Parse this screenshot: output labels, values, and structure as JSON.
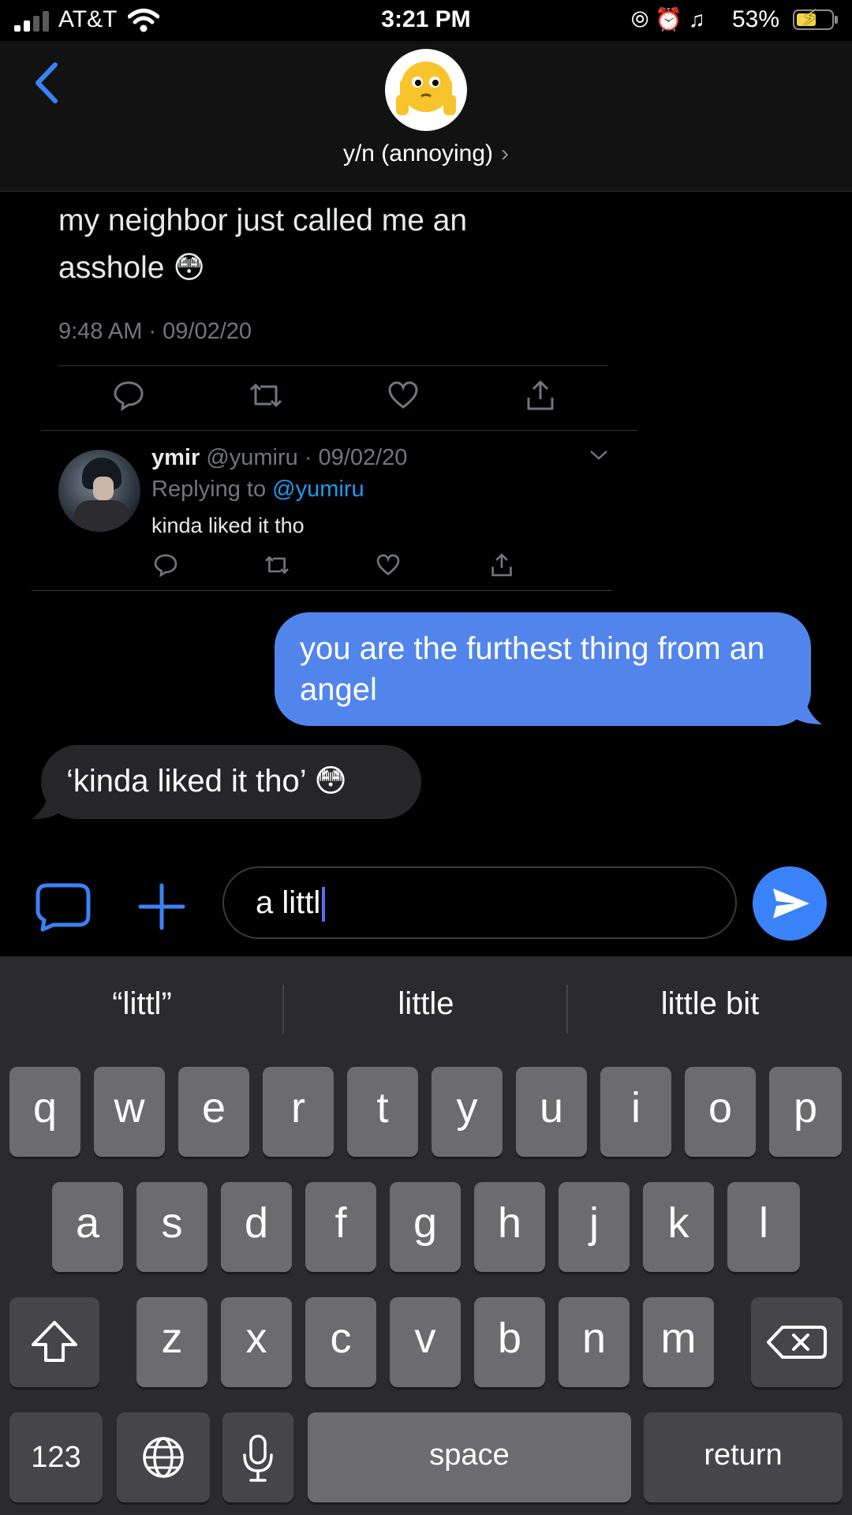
{
  "status_bar": {
    "carrier": "AT&T",
    "time": "3:21 PM",
    "battery_percent": "53%"
  },
  "header": {
    "contact_name": "y/n (annoying)",
    "avatar_icon": "smiley-middle-fingers-icon"
  },
  "tweet": {
    "text_line1": "my neighbor just called me an",
    "text_line2": "asshole",
    "emoji": "😳",
    "timestamp": "9:48 AM · 09/02/20",
    "reply": {
      "username": "ymir",
      "handle_date": "@yumiru · 09/02/20",
      "replying_prefix": "Replying to",
      "replying_handle": "@yumiru",
      "text": "kinda liked it tho"
    }
  },
  "messages": {
    "outgoing": "you are the furthest thing from an angel",
    "incoming": "‘kinda liked it tho’",
    "incoming_emoji": "😳"
  },
  "composer": {
    "input_value": "a littl"
  },
  "keyboard": {
    "suggestions": [
      "“littl”",
      "little",
      "little bit"
    ],
    "row1": [
      "q",
      "w",
      "e",
      "r",
      "t",
      "y",
      "u",
      "i",
      "o",
      "p"
    ],
    "row2": [
      "a",
      "s",
      "d",
      "f",
      "g",
      "h",
      "j",
      "k",
      "l"
    ],
    "row3": [
      "z",
      "x",
      "c",
      "v",
      "b",
      "n",
      "m"
    ],
    "numbers_label": "123",
    "space_label": "space",
    "return_label": "return"
  },
  "colors": {
    "outgoing_bubble": "#5285ec",
    "incoming_bubble": "#262628",
    "accent": "#3a82f7",
    "battery_fill": "#f5d547"
  }
}
